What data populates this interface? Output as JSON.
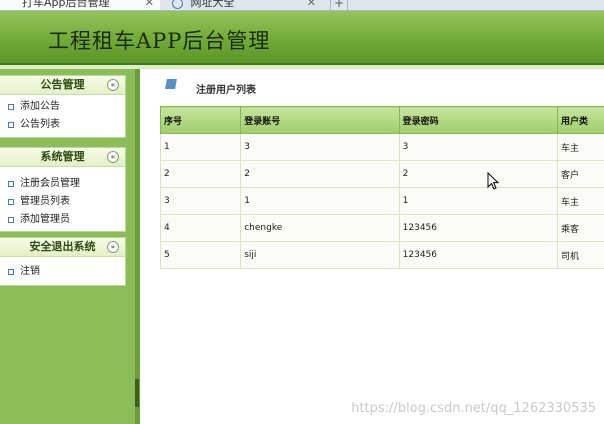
{
  "browser": {
    "tabs": [
      {
        "label": "打车App后台管理",
        "active": true
      },
      {
        "label": "网址大全",
        "active": false
      }
    ],
    "new_tab": "+"
  },
  "header": {
    "title": "工程租车APP后台管理"
  },
  "sidebar": {
    "groups": [
      {
        "title": "公告管理",
        "items": [
          "添加公告",
          "公告列表"
        ]
      },
      {
        "title": "系统管理",
        "items": [
          "注册会员管理",
          "管理员列表",
          "添加管理员"
        ]
      },
      {
        "title": "安全退出系统",
        "items": [
          "注销"
        ]
      }
    ],
    "collapse_glyph": "«"
  },
  "main": {
    "title": "注册用户列表",
    "table": {
      "columns": [
        "序号",
        "登录账号",
        "登录密码",
        "用户类"
      ],
      "rows": [
        [
          "1",
          "3",
          "3",
          "车主"
        ],
        [
          "2",
          "2",
          "2",
          "客户"
        ],
        [
          "3",
          "1",
          "1",
          "车主"
        ],
        [
          "4",
          "chengke",
          "123456",
          "乘客"
        ],
        [
          "5",
          "siji",
          "123456",
          "司机"
        ]
      ]
    }
  },
  "watermark": "https://blog.csdn.net/qq_1262330535",
  "colors": {
    "header_green": "#6ea835",
    "sidebar_green": "#8dbd58",
    "table_header": "#b3d986"
  }
}
